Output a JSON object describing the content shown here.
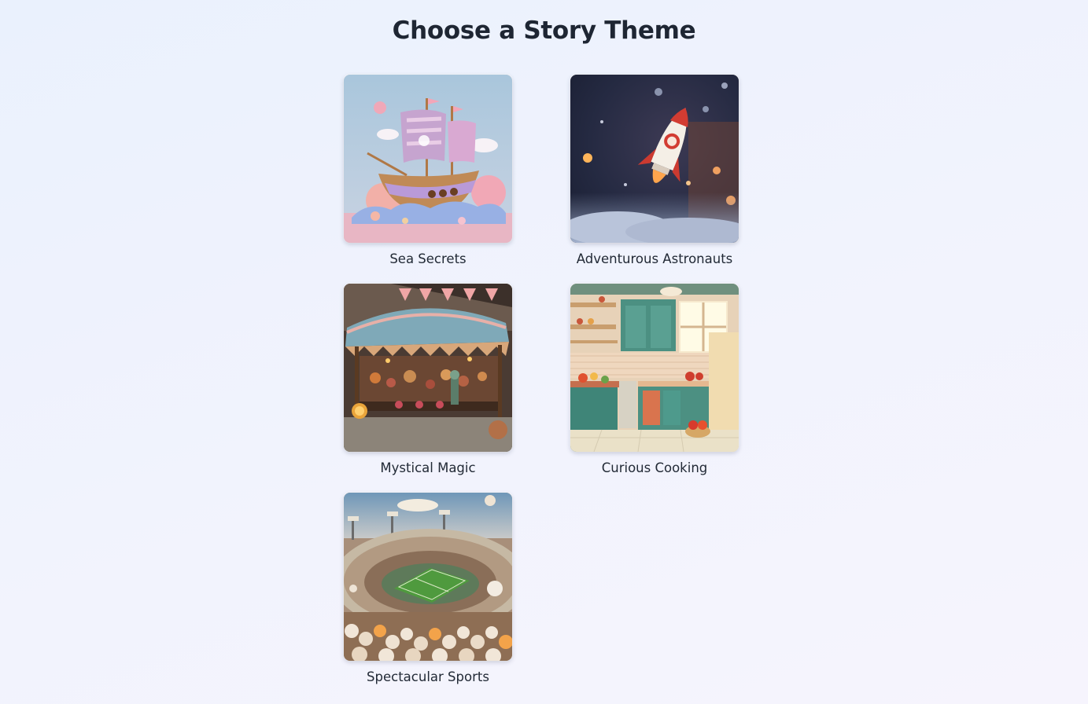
{
  "page": {
    "title": "Choose a Story Theme"
  },
  "themes": [
    {
      "label": "Sea Secrets",
      "image": "pirate-ship-image"
    },
    {
      "label": "Adventurous Astronauts",
      "image": "rocket-image"
    },
    {
      "label": "Mystical Magic",
      "image": "market-stall-image"
    },
    {
      "label": "Curious Cooking",
      "image": "kitchen-image"
    },
    {
      "label": "Spectacular Sports",
      "image": "stadium-image"
    }
  ]
}
